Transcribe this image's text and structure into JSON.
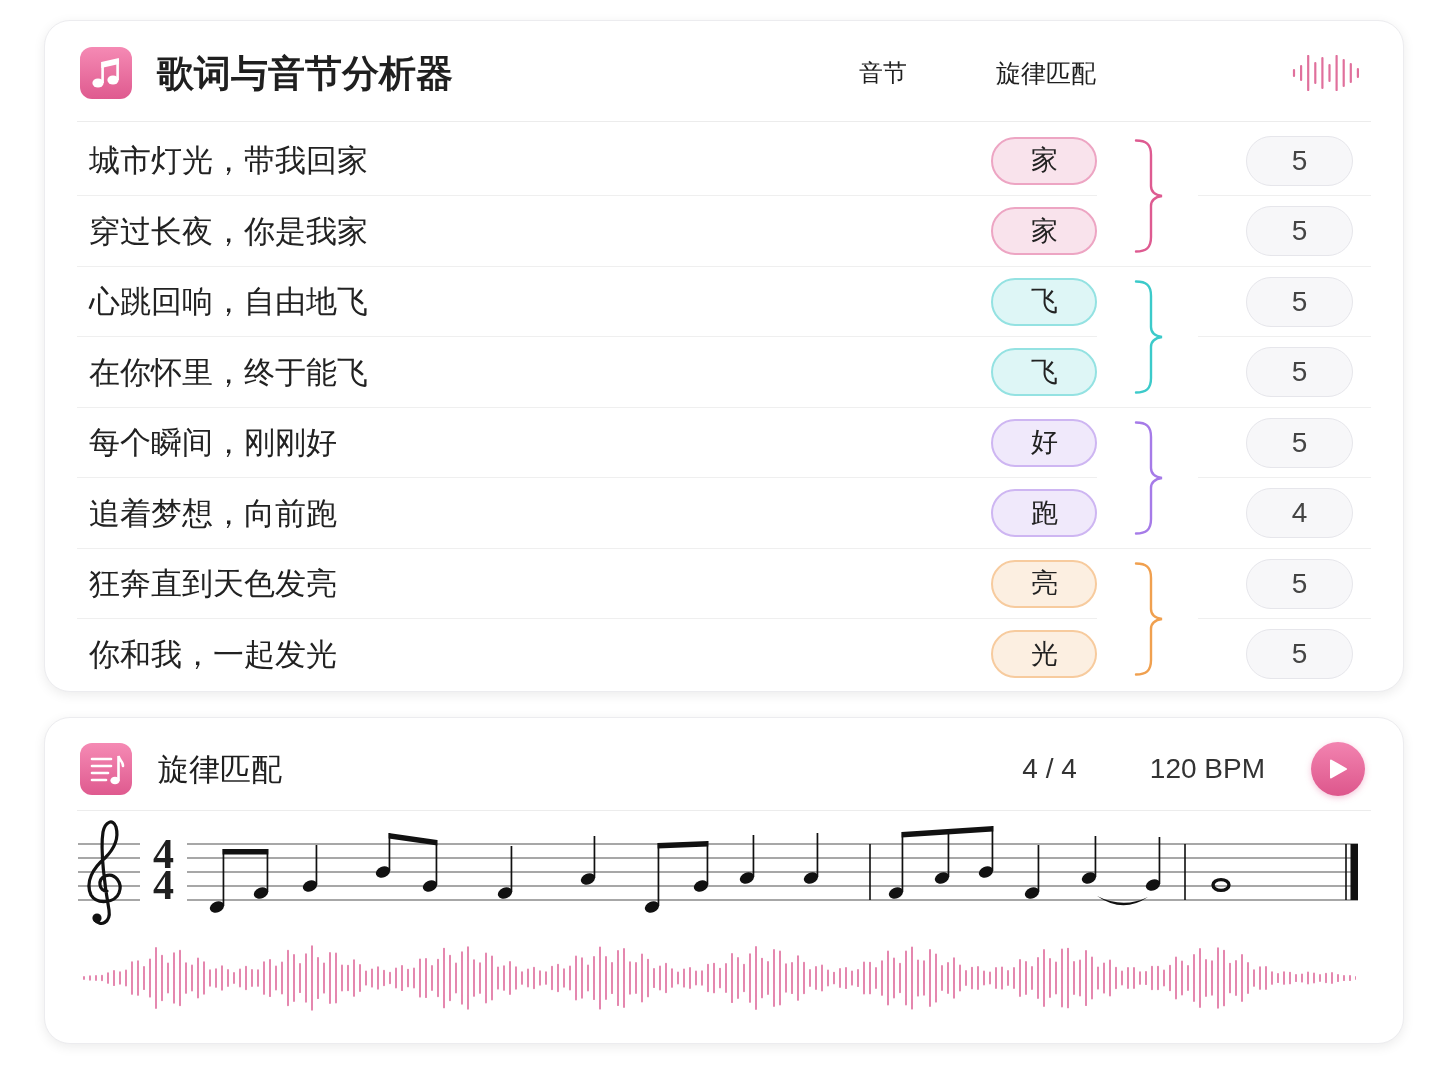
{
  "analyzer": {
    "title": "歌词与音节分析器",
    "columns": [
      "音节",
      "旋律匹配"
    ],
    "rhyme_groups": [
      {
        "color": "#de5b91",
        "lines": [
          {
            "lyric": "城市灯光，带我回家",
            "rhyme": "家",
            "count": "5"
          },
          {
            "lyric": "穿过长夜，你是我家",
            "rhyme": "家",
            "count": "5"
          }
        ]
      },
      {
        "color": "#3ccaca",
        "lines": [
          {
            "lyric": "心跳回响，自由地飞",
            "rhyme": "飞",
            "count": "5"
          },
          {
            "lyric": "在你怀里，终于能飞",
            "rhyme": "飞",
            "count": "5"
          }
        ]
      },
      {
        "color": "#a67be8",
        "lines": [
          {
            "lyric": "每个瞬间，刚刚好",
            "rhyme": "好",
            "count": "5"
          },
          {
            "lyric": "追着梦想，向前跑",
            "rhyme": "跑",
            "count": "4"
          }
        ]
      },
      {
        "color": "#f0a04f",
        "lines": [
          {
            "lyric": "狂奔直到天色发亮",
            "rhyme": "亮",
            "count": "5"
          },
          {
            "lyric": "你和我，一起发光",
            "rhyme": "光",
            "count": "5"
          }
        ]
      }
    ]
  },
  "melody": {
    "title": "旋律匹配",
    "time_signature": "4 / 4",
    "tempo": "120 BPM",
    "staff": {
      "time_signature": [
        "4",
        "4"
      ]
    }
  }
}
